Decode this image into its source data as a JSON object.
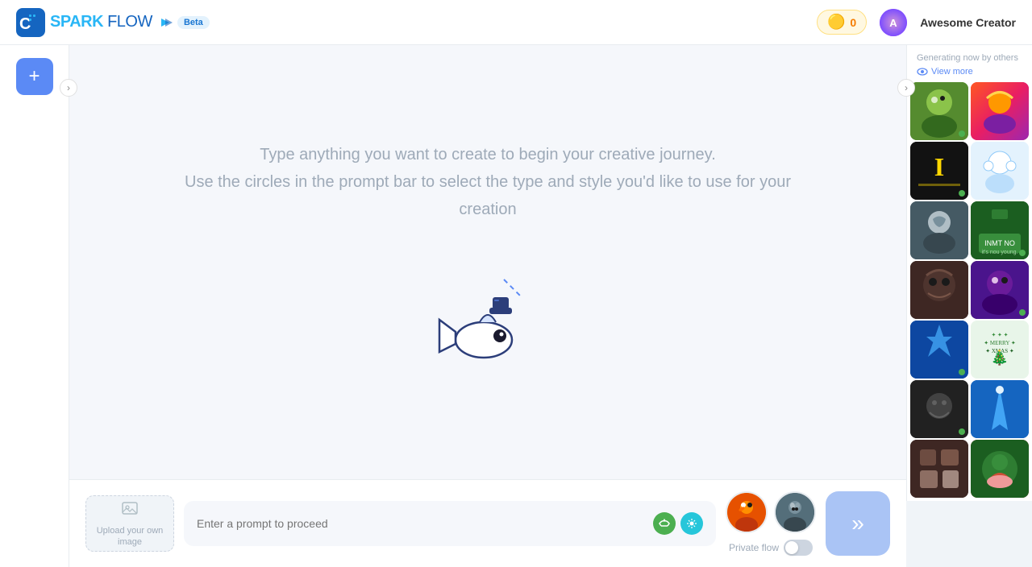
{
  "header": {
    "logo_text": "SPARK FLOW",
    "logo_spark": "SPARK",
    "logo_flow": "FLOW",
    "beta_label": "Beta",
    "coins_count": "0",
    "user_name": "Awesome Creator"
  },
  "sidebar": {
    "add_button_label": "+"
  },
  "main": {
    "headline": "Type anything you want to create to begin your creative journey.",
    "subline": "Use the circles in the prompt bar to select the type and style you'd like to use for your creation",
    "prompt_placeholder": "Enter a prompt to proceed",
    "private_flow_label": "Private flow",
    "send_icon": "»"
  },
  "right_panel": {
    "generating_label": "Generating now by others",
    "view_more_label": "View more"
  },
  "gallery": [
    {
      "id": "g1",
      "has_dot": true
    },
    {
      "id": "g2",
      "has_dot": false
    },
    {
      "id": "g3",
      "has_dot": true
    },
    {
      "id": "g4",
      "has_dot": false
    },
    {
      "id": "g5",
      "has_dot": false
    },
    {
      "id": "g6",
      "has_dot": true
    },
    {
      "id": "g7",
      "has_dot": false
    },
    {
      "id": "g8",
      "has_dot": true
    },
    {
      "id": "g9",
      "has_dot": true
    },
    {
      "id": "g10",
      "has_dot": false
    },
    {
      "id": "g11",
      "has_dot": true
    },
    {
      "id": "g12",
      "has_dot": false
    },
    {
      "id": "g13",
      "has_dot": false
    },
    {
      "id": "g14",
      "has_dot": false
    }
  ]
}
